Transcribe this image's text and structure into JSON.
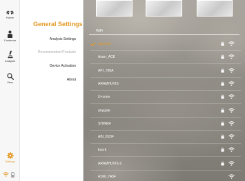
{
  "rail": {
    "items": [
      {
        "label": "Home",
        "icon": "home-icon"
      },
      {
        "label": "Customer",
        "icon": "customer-icon"
      },
      {
        "label": "Analysis",
        "icon": "analysis-icon"
      },
      {
        "label": "View",
        "icon": "view-icon"
      }
    ],
    "settings_label": "Settings"
  },
  "settings": {
    "title": "General Settings",
    "menu": [
      {
        "label": "Analysis Settings",
        "disabled": false
      },
      {
        "label": "Recommended Products",
        "disabled": true
      },
      {
        "label": "Device Activation",
        "disabled": false
      },
      {
        "label": "About",
        "disabled": false
      }
    ]
  },
  "wifi": {
    "header": "WiFi",
    "networks": [
      {
        "name": "apoinoin",
        "connected": true,
        "locked": true
      },
      {
        "name": "Aram_ACE",
        "connected": false,
        "locked": true
      },
      {
        "name": "API_780A",
        "connected": false,
        "locked": true
      },
      {
        "name": "ARAMHUVIS",
        "connected": false,
        "locked": true
      },
      {
        "name": "U+zone",
        "connected": false,
        "locked": true
      },
      {
        "name": "anygate",
        "connected": false,
        "locked": true
      },
      {
        "name": "SHINER",
        "connected": false,
        "locked": true
      },
      {
        "name": "ABI_81DF",
        "connected": false,
        "locked": true
      },
      {
        "name": "koa-k",
        "connected": false,
        "locked": true
      },
      {
        "name": "ARAMHUVIS-2",
        "connected": false,
        "locked": true
      },
      {
        "name": "ASW_7A5F",
        "connected": false,
        "locked": false
      }
    ]
  },
  "colors": {
    "accent": "#e39a25",
    "rail_bg": "#f7f7f7"
  }
}
